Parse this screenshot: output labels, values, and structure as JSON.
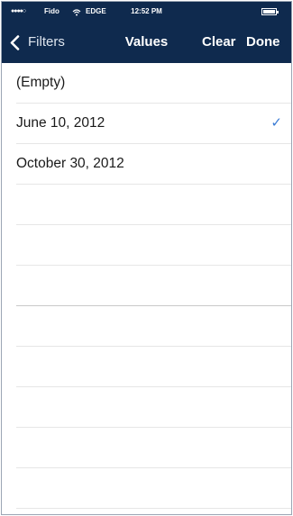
{
  "status_bar": {
    "signal": "●●●●○",
    "carrier": "Fido",
    "network": "EDGE",
    "time": "12:52 PM"
  },
  "nav": {
    "back_label": "Filters",
    "title": "Values",
    "clear_label": "Clear",
    "done_label": "Done"
  },
  "values": [
    {
      "label": "(Empty)",
      "checked": false
    },
    {
      "label": "June 10, 2012",
      "checked": true
    },
    {
      "label": "October 30, 2012",
      "checked": false
    }
  ],
  "check_glyph": "✓",
  "colors": {
    "nav_bar": "#0f2a4e",
    "checkmark": "#3a7bd5"
  }
}
